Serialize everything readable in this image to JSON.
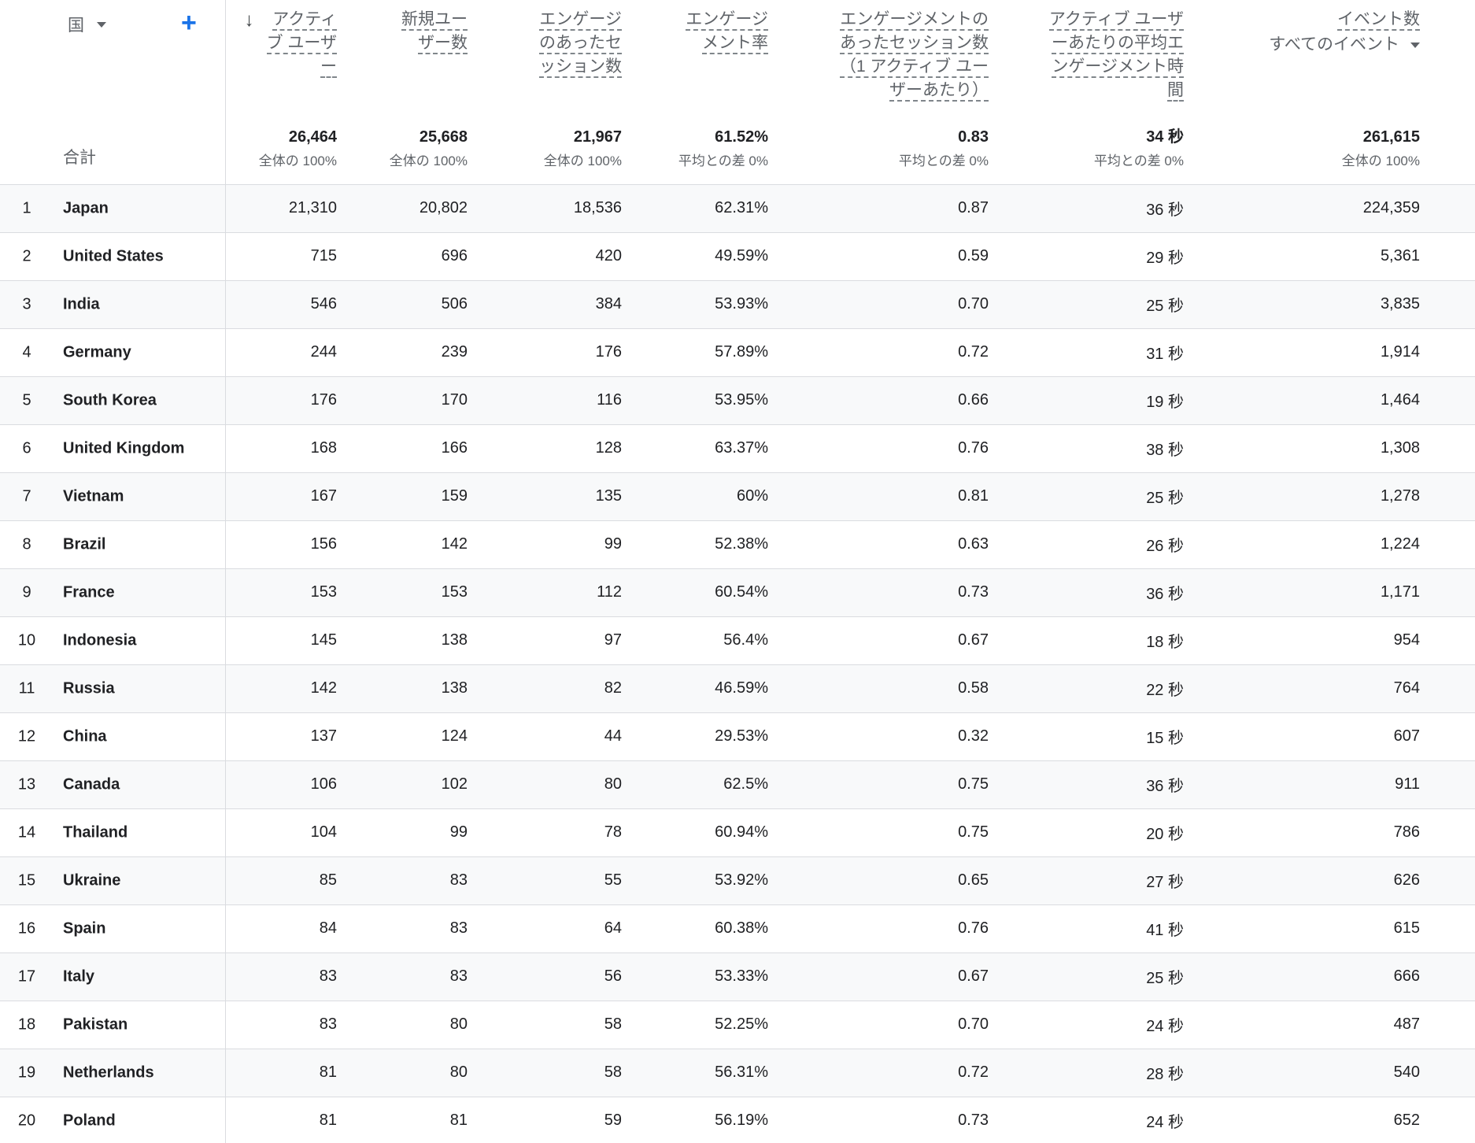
{
  "dimension": {
    "label": "国"
  },
  "metrics": [
    {
      "lines": [
        "アクティ",
        "ブ ユーザ",
        "ー"
      ]
    },
    {
      "lines": [
        "新規ユー",
        "ザー数"
      ]
    },
    {
      "lines": [
        "エンゲージ",
        "のあったセ",
        "ッション数"
      ]
    },
    {
      "lines": [
        "エンゲージ",
        "メント率"
      ]
    },
    {
      "lines": [
        "エンゲージメントの",
        "あったセッション数",
        "（1 アクティブ ユー",
        "ザーあたり）"
      ]
    },
    {
      "lines": [
        "アクティブ ユーザ",
        "ーあたりの平均エ",
        "ンゲージメント時",
        "間"
      ]
    },
    {
      "lines": [
        "イベント数"
      ],
      "sub": "すべてのイベント"
    }
  ],
  "totals": {
    "label": "合計",
    "cells": [
      {
        "value": "26,464",
        "sub": "全体の 100%"
      },
      {
        "value": "25,668",
        "sub": "全体の 100%"
      },
      {
        "value": "21,967",
        "sub": "全体の 100%"
      },
      {
        "value": "61.52%",
        "sub": "平均との差 0%"
      },
      {
        "value": "0.83",
        "sub": "平均との差 0%"
      },
      {
        "value": "34 秒",
        "sub": "平均との差 0%"
      },
      {
        "value": "261,615",
        "sub": "全体の 100%"
      }
    ]
  },
  "rows": [
    {
      "rank": "1",
      "country": "Japan",
      "values": [
        "21,310",
        "20,802",
        "18,536",
        "62.31%",
        "0.87",
        "36 秒",
        "224,359"
      ]
    },
    {
      "rank": "2",
      "country": "United States",
      "values": [
        "715",
        "696",
        "420",
        "49.59%",
        "0.59",
        "29 秒",
        "5,361"
      ]
    },
    {
      "rank": "3",
      "country": "India",
      "values": [
        "546",
        "506",
        "384",
        "53.93%",
        "0.70",
        "25 秒",
        "3,835"
      ]
    },
    {
      "rank": "4",
      "country": "Germany",
      "values": [
        "244",
        "239",
        "176",
        "57.89%",
        "0.72",
        "31 秒",
        "1,914"
      ]
    },
    {
      "rank": "5",
      "country": "South Korea",
      "values": [
        "176",
        "170",
        "116",
        "53.95%",
        "0.66",
        "19 秒",
        "1,464"
      ]
    },
    {
      "rank": "6",
      "country": "United Kingdom",
      "values": [
        "168",
        "166",
        "128",
        "63.37%",
        "0.76",
        "38 秒",
        "1,308"
      ]
    },
    {
      "rank": "7",
      "country": "Vietnam",
      "values": [
        "167",
        "159",
        "135",
        "60%",
        "0.81",
        "25 秒",
        "1,278"
      ]
    },
    {
      "rank": "8",
      "country": "Brazil",
      "values": [
        "156",
        "142",
        "99",
        "52.38%",
        "0.63",
        "26 秒",
        "1,224"
      ]
    },
    {
      "rank": "9",
      "country": "France",
      "values": [
        "153",
        "153",
        "112",
        "60.54%",
        "0.73",
        "36 秒",
        "1,171"
      ]
    },
    {
      "rank": "10",
      "country": "Indonesia",
      "values": [
        "145",
        "138",
        "97",
        "56.4%",
        "0.67",
        "18 秒",
        "954"
      ]
    },
    {
      "rank": "11",
      "country": "Russia",
      "values": [
        "142",
        "138",
        "82",
        "46.59%",
        "0.58",
        "22 秒",
        "764"
      ]
    },
    {
      "rank": "12",
      "country": "China",
      "values": [
        "137",
        "124",
        "44",
        "29.53%",
        "0.32",
        "15 秒",
        "607"
      ]
    },
    {
      "rank": "13",
      "country": "Canada",
      "values": [
        "106",
        "102",
        "80",
        "62.5%",
        "0.75",
        "36 秒",
        "911"
      ]
    },
    {
      "rank": "14",
      "country": "Thailand",
      "values": [
        "104",
        "99",
        "78",
        "60.94%",
        "0.75",
        "20 秒",
        "786"
      ]
    },
    {
      "rank": "15",
      "country": "Ukraine",
      "values": [
        "85",
        "83",
        "55",
        "53.92%",
        "0.65",
        "27 秒",
        "626"
      ]
    },
    {
      "rank": "16",
      "country": "Spain",
      "values": [
        "84",
        "83",
        "64",
        "60.38%",
        "0.76",
        "41 秒",
        "615"
      ]
    },
    {
      "rank": "17",
      "country": "Italy",
      "values": [
        "83",
        "83",
        "56",
        "53.33%",
        "0.67",
        "25 秒",
        "666"
      ]
    },
    {
      "rank": "18",
      "country": "Pakistan",
      "values": [
        "83",
        "80",
        "58",
        "52.25%",
        "0.70",
        "24 秒",
        "487"
      ]
    },
    {
      "rank": "19",
      "country": "Netherlands",
      "values": [
        "81",
        "80",
        "58",
        "56.31%",
        "0.72",
        "28 秒",
        "540"
      ]
    },
    {
      "rank": "20",
      "country": "Poland",
      "values": [
        "81",
        "81",
        "59",
        "56.19%",
        "0.73",
        "24 秒",
        "652"
      ]
    }
  ],
  "icons": {
    "sort": "arrow-down-icon",
    "add": "plus-icon",
    "dropdown": "caret-down-icon",
    "accent_color": "#1a73e8"
  }
}
